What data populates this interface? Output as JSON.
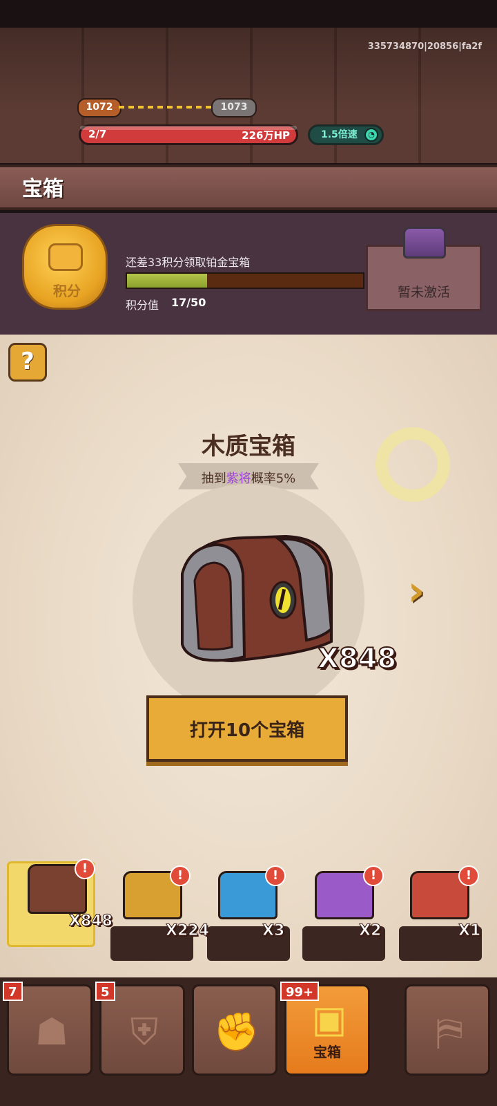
{
  "session_id": "335734870|20856|fa2f",
  "hud": {
    "level_current": "1072",
    "level_next": "1073",
    "wave": "2/7",
    "hp": "226万HP",
    "speed_label": "1.5倍速"
  },
  "page_title": "宝箱",
  "points": {
    "prompt": "还差33积分领取铂金宝箱",
    "label": "积分值",
    "value": "17/50",
    "progress": 0.34,
    "badge_label": "积分",
    "reward_status": "暂未激活"
  },
  "chest": {
    "title": "木质宝箱",
    "odds_prefix": "抽到",
    "odds_highlight": "紫将",
    "odds_suffix": "概率5%",
    "count": "X848",
    "open_button": "打开10个宝箱"
  },
  "shelf": [
    {
      "name": "wooden-chest",
      "count": "X848",
      "alert": "!",
      "color": "#7a4030"
    },
    {
      "name": "golden-chest",
      "count": "X224",
      "alert": "!",
      "color": "#d8a030"
    },
    {
      "name": "blue-chest",
      "count": "X3",
      "alert": "!",
      "color": "#3a9ad8"
    },
    {
      "name": "purple-chest",
      "count": "X2",
      "alert": "!",
      "color": "#9a5ac8"
    },
    {
      "name": "red-chest",
      "count": "X1",
      "alert": "!",
      "color": "#c84a3a"
    }
  ],
  "nav": {
    "tab1_badge": "7",
    "tab2_badge": "5",
    "chest_badge": "99+",
    "chest_label": "宝箱"
  },
  "colors": {
    "accent": "#e8ab37",
    "hp": "#d23b3b",
    "purple_highlight": "#9b3ed4",
    "active_tab": "#f39c3a"
  }
}
